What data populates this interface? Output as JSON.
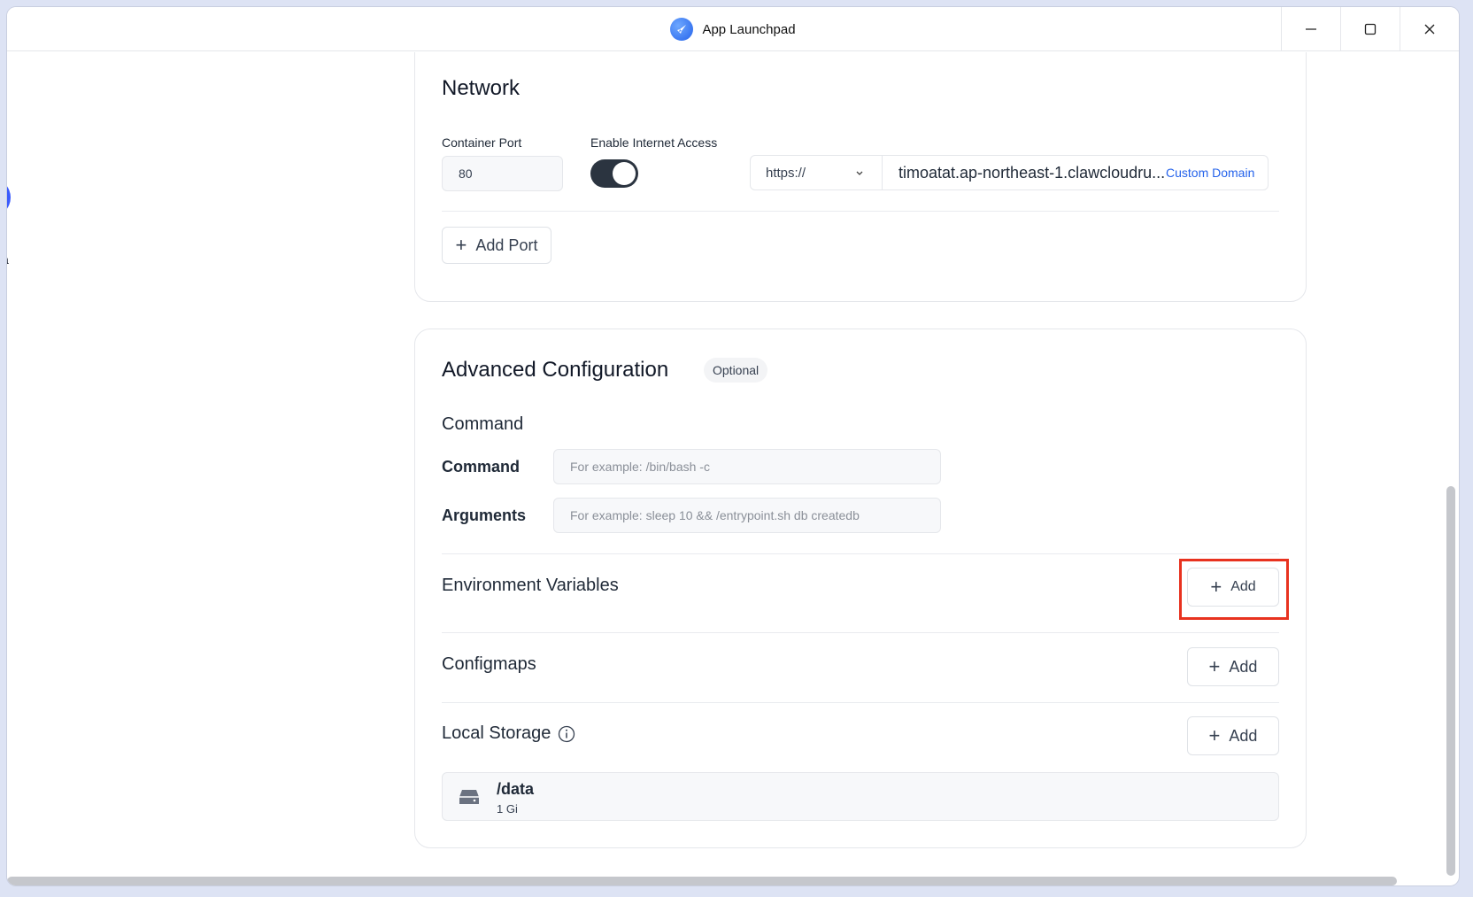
{
  "window": {
    "title": "App Launchpad"
  },
  "network": {
    "heading": "Network",
    "container_port_label": "Container Port",
    "container_port_value": "80",
    "internet_label": "Enable Internet Access",
    "internet_enabled": true,
    "protocol": "https://",
    "domain": "timoatat.ap-northeast-1.clawcloudru...",
    "custom_domain": "Custom Domain",
    "add_port": "Add Port"
  },
  "advanced": {
    "heading": "Advanced Configuration",
    "badge": "Optional",
    "command_section": "Command",
    "command_label": "Command",
    "command_placeholder": "For example:  /bin/bash -c",
    "arguments_label": "Arguments",
    "arguments_placeholder": "For example:  sleep 10 && /entrypoint.sh db createdb",
    "env_label": "Environment Variables",
    "configmaps_label": "Configmaps",
    "local_storage_label": "Local Storage",
    "add_label": "Add",
    "storage_items": [
      {
        "path": "/data",
        "size": "1 Gi"
      }
    ]
  },
  "sidebar_partial_text": "a",
  "colors": {
    "toggle_on": "#2b3440",
    "link": "#2563eb",
    "highlight": "#e8321f"
  }
}
